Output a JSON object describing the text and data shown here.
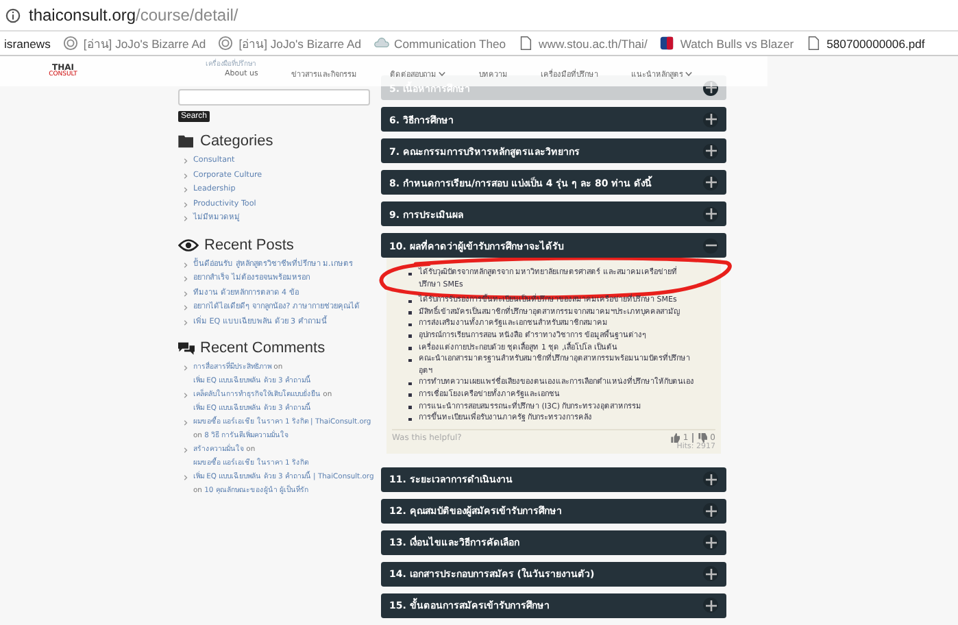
{
  "browser": {
    "url_host": "thaiconsult.org",
    "url_path": "/course/detail/",
    "bookmarks": [
      {
        "kind": "plain",
        "label": "isranews",
        "faded": false
      },
      {
        "kind": "spiral",
        "label": "[อ่าน] JoJo's Bizarre Ad",
        "faded": true
      },
      {
        "kind": "spiral",
        "label": "[อ่าน] JoJo's Bizarre Ad",
        "faded": true
      },
      {
        "kind": "cloud",
        "label": "Communication Theo",
        "faded": true
      },
      {
        "kind": "page",
        "label": "www.stou.ac.th/Thai/",
        "faded": true
      },
      {
        "kind": "sport",
        "label": "Watch Bulls vs Blazer",
        "faded": true
      },
      {
        "kind": "page",
        "label": "580700000006.pdf",
        "faded": false
      }
    ]
  },
  "nav": {
    "logo_top": "THAI",
    "logo_bottom": "CONSULT",
    "submenu_hint": "เครื่องมือที่ปรึกษา",
    "items": [
      {
        "label": "About us",
        "dropdown": false
      },
      {
        "label": "ข่าวสารและกิจกรรม",
        "dropdown": false
      },
      {
        "label": "ติดต่อสอบถาม",
        "dropdown": true
      },
      {
        "label": "บทความ",
        "dropdown": false
      },
      {
        "label": "เครื่องมือที่ปรึกษา",
        "dropdown": false
      },
      {
        "label": "แนะนำหลักสูตร",
        "dropdown": true
      }
    ]
  },
  "sidebar": {
    "search_button": "Search",
    "categories": {
      "title": "Categories",
      "items": [
        "Consultant",
        "Corporate Culture",
        "Leadership",
        "Productivity Tool",
        "ไม่มีหมวดหมู่"
      ]
    },
    "recent_posts": {
      "title": "Recent Posts",
      "items": [
        "ปั้นดีอ่อนรับ สู่หลักสูตรวิชาชีพที่ปรึกษา ม.เกษตร",
        "อยากสำเร็จ ไม่ต้องรอจนพร้อมหรอก",
        "ทีมงาน ด้วยหลักการตลาด 4 ข้อ",
        "อยากได้ไอเดียดีๆ จากลูกน้อง? ภาษากายช่วยคุณได้",
        "เพิ่ม EQ แบบเฉียบพลัน ด้วย 3 คำถามนี้"
      ]
    },
    "recent_comments": {
      "title": "Recent Comments",
      "items": [
        {
          "author": "การสื่อสารที่มีประสิทธิภาพ",
          "on": "on",
          "post": "เพิ่ม EQ แบบเฉียบพลัน ด้วย 3 คำถามนี้"
        },
        {
          "author": "เคล็ดลับในการทำธุรกิจให้เติบโตแบบยั่งยืน",
          "on": "on",
          "post": "เพิ่ม EQ แบบเฉียบพลัน ด้วย 3 คำถามนี้"
        },
        {
          "author": "ผมขอซื้อ แอร์เอเชีย ในราคา 1 ริงกิต | ThaiConsult.org",
          "on": "on",
          "post": "8 วิธี การันตีเพิ่มความมั่นใจ"
        },
        {
          "author": "สร้างความมั่นใจ",
          "on": "on",
          "post": "ผมขอซื้อ แอร์เอเชีย ในราคา 1 ริงกิต"
        },
        {
          "author": "เพิ่ม EQ แบบเฉียบพลัน ด้วย 3 คำถามนี้ | ThaiConsult.org",
          "on": "on",
          "post": "10 คุณลักษณะของผู้นำ ผู้เป็นที่รัก"
        }
      ]
    }
  },
  "accordion": [
    {
      "title": "5. เนื้อหาการศึกษา",
      "expanded": false
    },
    {
      "title": "6. วิธีการศึกษา",
      "expanded": false
    },
    {
      "title": "7. คณะกรรมการบริหารหลักสูตรและวิทยากร",
      "expanded": false
    },
    {
      "title": "8. กำหนดการเรียน/การสอบ แบ่งเป็น 4 รุ่น ๆ ละ 80 ท่าน ดังนี้",
      "expanded": false
    },
    {
      "title": "9. การประเมินผล",
      "expanded": false
    },
    {
      "title": "10. ผลที่คาดว่าผู้เข้ารับการศึกษาจะได้รับ",
      "expanded": true,
      "bullets": [
        {
          "text": "ได้รับวุฒิบัตรจากหลักสูตรจาก มหาวิทยาลัยเกษตรศาสตร์ และสมาคมเครือข่ายที่ปรึกษา SMEs",
          "circled": true
        },
        {
          "text": "ได้รับการรับรองการขึ้นทะเบียนเป็นที่ปรึกษาของสมาคมเครือข่ายที่ปรึกษา SMEs",
          "circled": false
        },
        {
          "text": "มีสิทธิ์เข้าสมัครเป็นสมาชิกที่ปรึกษาอุตสาหกรรมจากสมาคมฯประเภทบุคคลสามัญ",
          "circled": false
        },
        {
          "text": "การส่งเสริมงานทั้งภาครัฐและเอกชนสำหรับสมาชิกสมาคม",
          "circled": false
        },
        {
          "text": "อุปกรณ์การเรียนการสอน หนังสือ ตำราทางวิชาการ ข้อมูลพื้นฐานต่างๆ",
          "circled": false
        },
        {
          "text": "เครื่องแต่งกายประกอบด้วย ชุดเสื้อสูท 1 ชุด ,เสื้อโปโล เป็นต้น",
          "circled": false
        },
        {
          "text": "คณะนำเอกสารมาตรฐานสำหรับสมาชิกที่ปรึกษาอุตสาหกรรมพร้อมนามบัตรที่ปรึกษาอุตฯ",
          "circled": false
        },
        {
          "text": "การทำบทความเผยแพร่ชื่อเสียงของตนเองและการเลือกตำแหน่งที่ปรึกษาให้กับตนเอง",
          "circled": false
        },
        {
          "text": "การเชื่อมโยงเครือข่ายทั้งภาครัฐและเอกชน",
          "circled": false
        },
        {
          "text": "การแนะนำการสอบสมรรถนะที่ปรึกษา (I3C) กับกระทรวงอุตสาหกรรม",
          "circled": false
        },
        {
          "text": "การขึ้นทะเบียนเพื่อรับงานภาครัฐ กับกระทรวงการคลัง",
          "circled": false
        }
      ],
      "helpful": "Was this helpful?",
      "likes": "1",
      "dislikes": "0",
      "hits": "Hits: 2917"
    },
    {
      "title": "11. ระยะเวลาการดำเนินงาน",
      "expanded": false
    },
    {
      "title": "12. คุณสมบัติของผู้สมัครเข้ารับการศึกษา",
      "expanded": false
    },
    {
      "title": "13. เงื่อนไขและวิธีการคัดเลือก",
      "expanded": false
    },
    {
      "title": "14. เอกสารประกอบการสมัคร (ในวันรายงานตัว)",
      "expanded": false
    },
    {
      "title": "15. ขั้นตอนการสมัครเข้ารับการศึกษา",
      "expanded": false
    }
  ]
}
